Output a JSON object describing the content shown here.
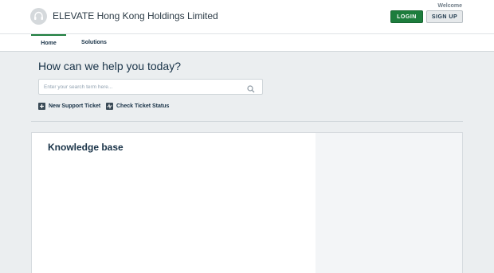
{
  "header": {
    "company_name": "ELEVATE Hong Kong Holdings Limited",
    "welcome_text": "Welcome",
    "login_label": "LOGIN",
    "signup_label": "SIGN UP"
  },
  "nav": {
    "tabs": [
      {
        "label": "Home",
        "active": true
      },
      {
        "label": "Solutions",
        "active": false
      }
    ]
  },
  "hero": {
    "title": "How can we help you today?",
    "search_placeholder": "Enter your search term here...",
    "actions": [
      {
        "label": "New Support Ticket",
        "icon": "plus-icon"
      },
      {
        "label": "Check Ticket Status",
        "icon": "activity-icon"
      }
    ]
  },
  "main": {
    "kb_title": "Knowledge base"
  },
  "colors": {
    "accent": "#1d7d3d",
    "background": "#ebeef0",
    "text": "#183247"
  }
}
